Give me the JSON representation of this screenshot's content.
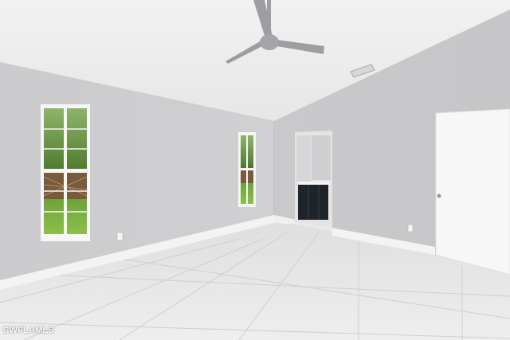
{
  "watermark": "SWFLAMLS"
}
